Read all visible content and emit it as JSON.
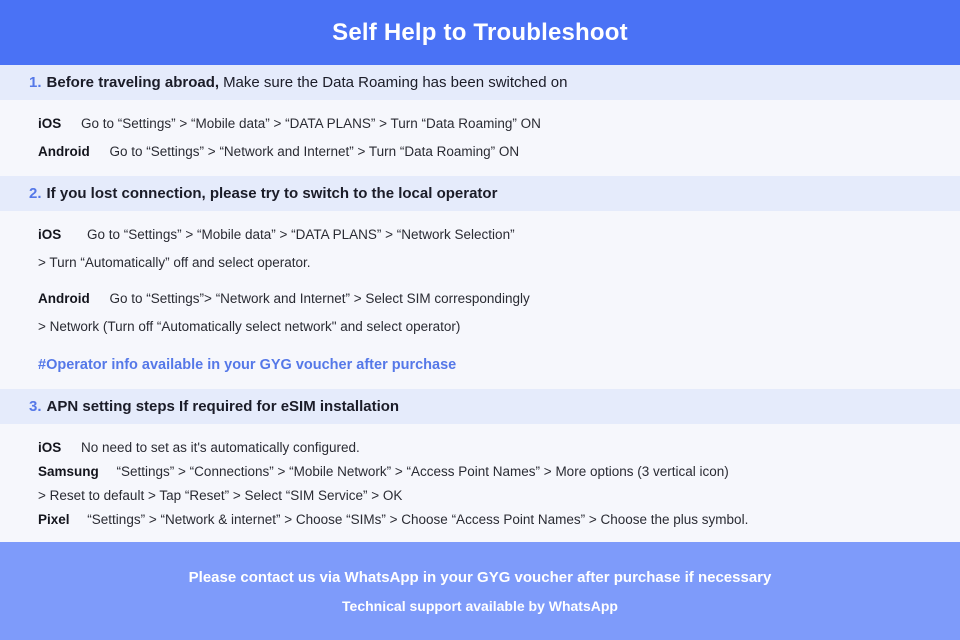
{
  "header": {
    "title": "Self Help to Troubleshoot",
    "background_color": "#4a72f5",
    "text_color": "#ffffff"
  },
  "colors": {
    "header_blue": "#4a72f5",
    "footer_blue": "#7e9bfa",
    "band_blue": "#e5ebfb",
    "body_background": "#f6f7fc",
    "accent_blue": "#5578e8",
    "body_text": "#2a2b33"
  },
  "sections": [
    {
      "number": "1.",
      "lead": "Before traveling abroad,",
      "rest": "Make sure the Data Roaming has been switched on",
      "rest_bold": false,
      "steps": [
        {
          "label": "iOS",
          "text": "Go to “Settings” > “Mobile data” > “DATA PLANS” > Turn “Data Roaming” ON"
        },
        {
          "label": "Android",
          "text": "Go to “Settings” > “Network and Internet” > Turn “Data Roaming” ON"
        }
      ]
    },
    {
      "number": "2.",
      "lead": "If you lost connection, please try to switch to the local operator",
      "rest": "",
      "rest_bold": true,
      "steps": [
        {
          "label": "iOS",
          "text": "Go to “Settings” > “Mobile data” > “DATA PLANS” > “Network Selection”"
        },
        {
          "label": "",
          "text": "> Turn “Automatically” off and select operator."
        },
        {
          "label": "Android",
          "text": "Go to “Settings”>  “Network and Internet” > Select SIM correspondingly"
        },
        {
          "label": "",
          "text": "> Network (Turn off “Automatically select network\" and select operator)"
        }
      ],
      "note": "#Operator info available in your GYG voucher after purchase"
    },
    {
      "number": "3.",
      "lead": "APN setting steps If required for eSIM installation",
      "rest": "",
      "rest_bold": true,
      "steps": [
        {
          "label": "iOS",
          "text": "No need to set as it's automatically configured."
        },
        {
          "label": "Samsung",
          "text": "“Settings” > “Connections” > “Mobile Network” > “Access Point Names” > More options (3 vertical icon)"
        },
        {
          "label": "",
          "text": "> Reset to default > Tap “Reset” > Select “SIM Service” > OK"
        },
        {
          "label": "Pixel",
          "text": "“Settings” > “Network & internet” > Choose “SIMs” > Choose “Access Point Names” > Choose the plus symbol."
        }
      ]
    }
  ],
  "footer": {
    "line1": "Please contact us via WhatsApp  in your GYG voucher after purchase if necessary",
    "line2": "Technical support available by WhatsApp"
  }
}
